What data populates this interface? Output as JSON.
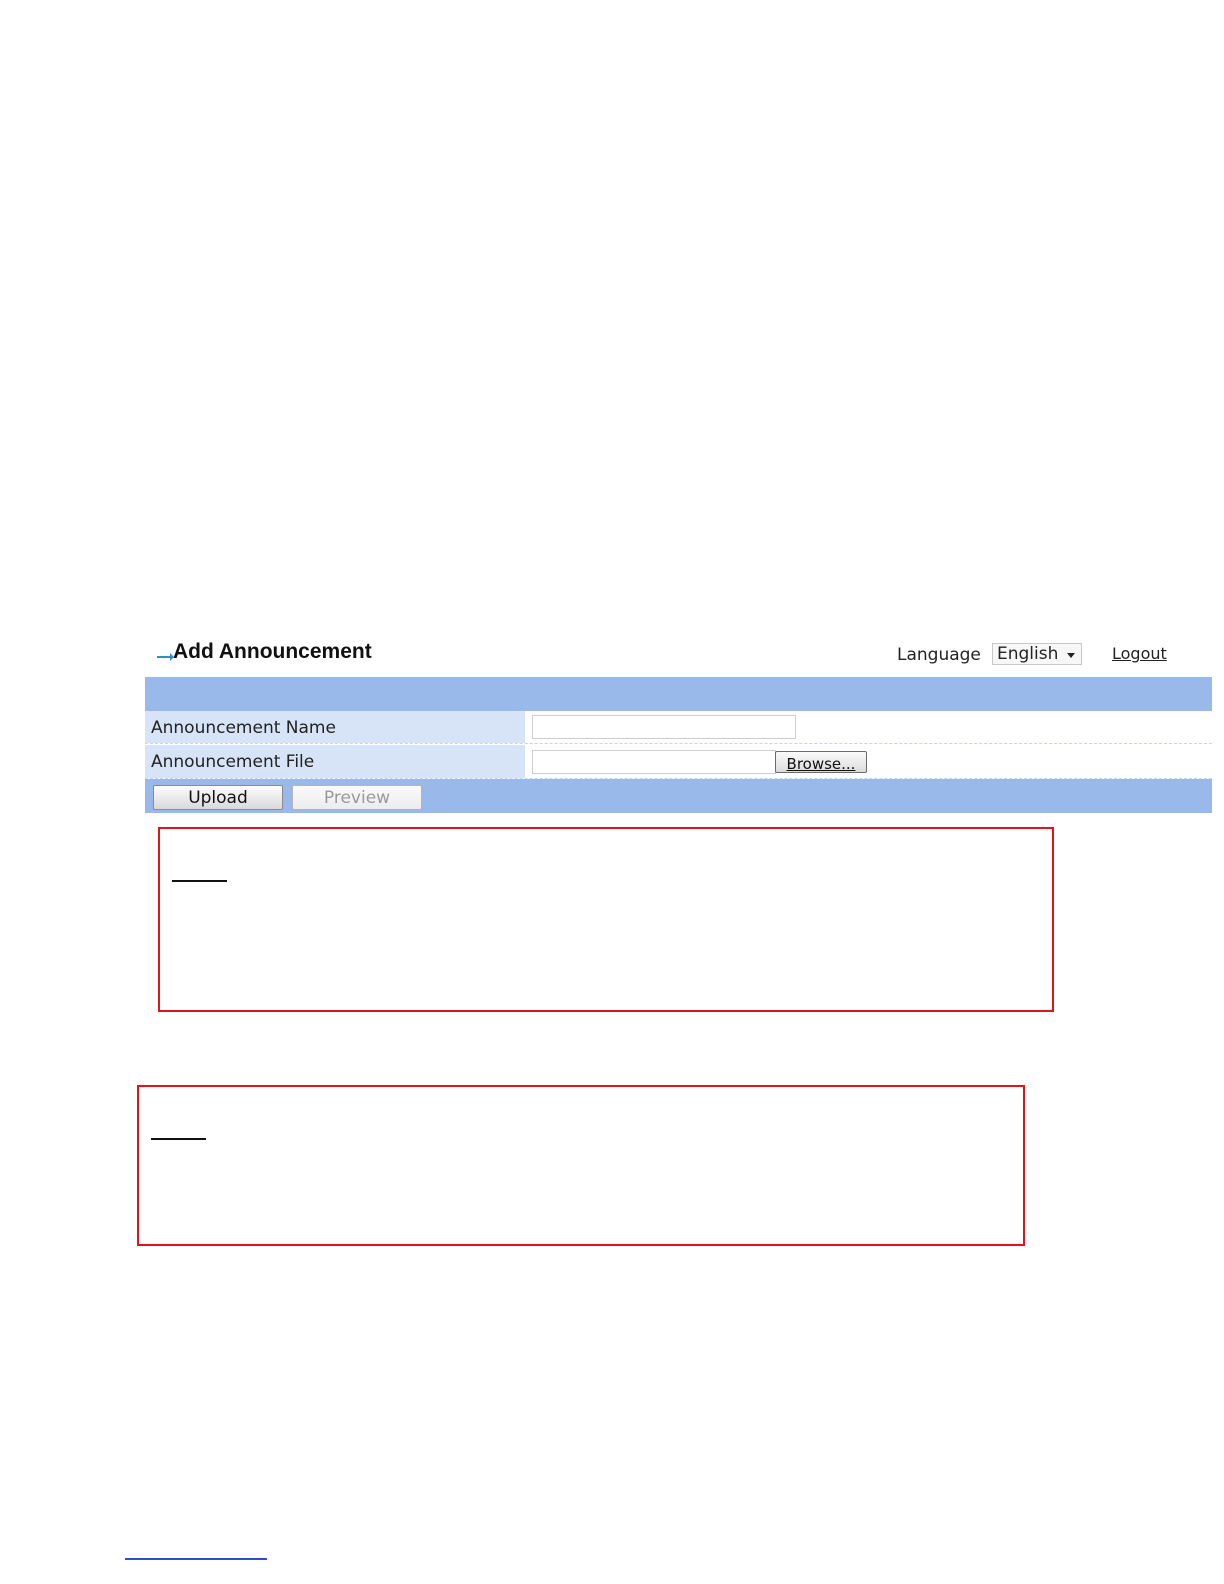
{
  "header": {
    "title": "Add Announcement",
    "language_label": "Language",
    "language_value": "English",
    "logout_label": "Logout"
  },
  "form": {
    "rows": [
      {
        "label": "Announcement Name",
        "value": ""
      },
      {
        "label": "Announcement File",
        "value": ""
      }
    ],
    "browse_label": "Browse..."
  },
  "actions": {
    "upload_label": "Upload",
    "preview_label": "Preview"
  },
  "colors": {
    "panel_bar": "#99b9ea",
    "label_cell": "#d7e3f6",
    "note_border": "#e0141e"
  }
}
